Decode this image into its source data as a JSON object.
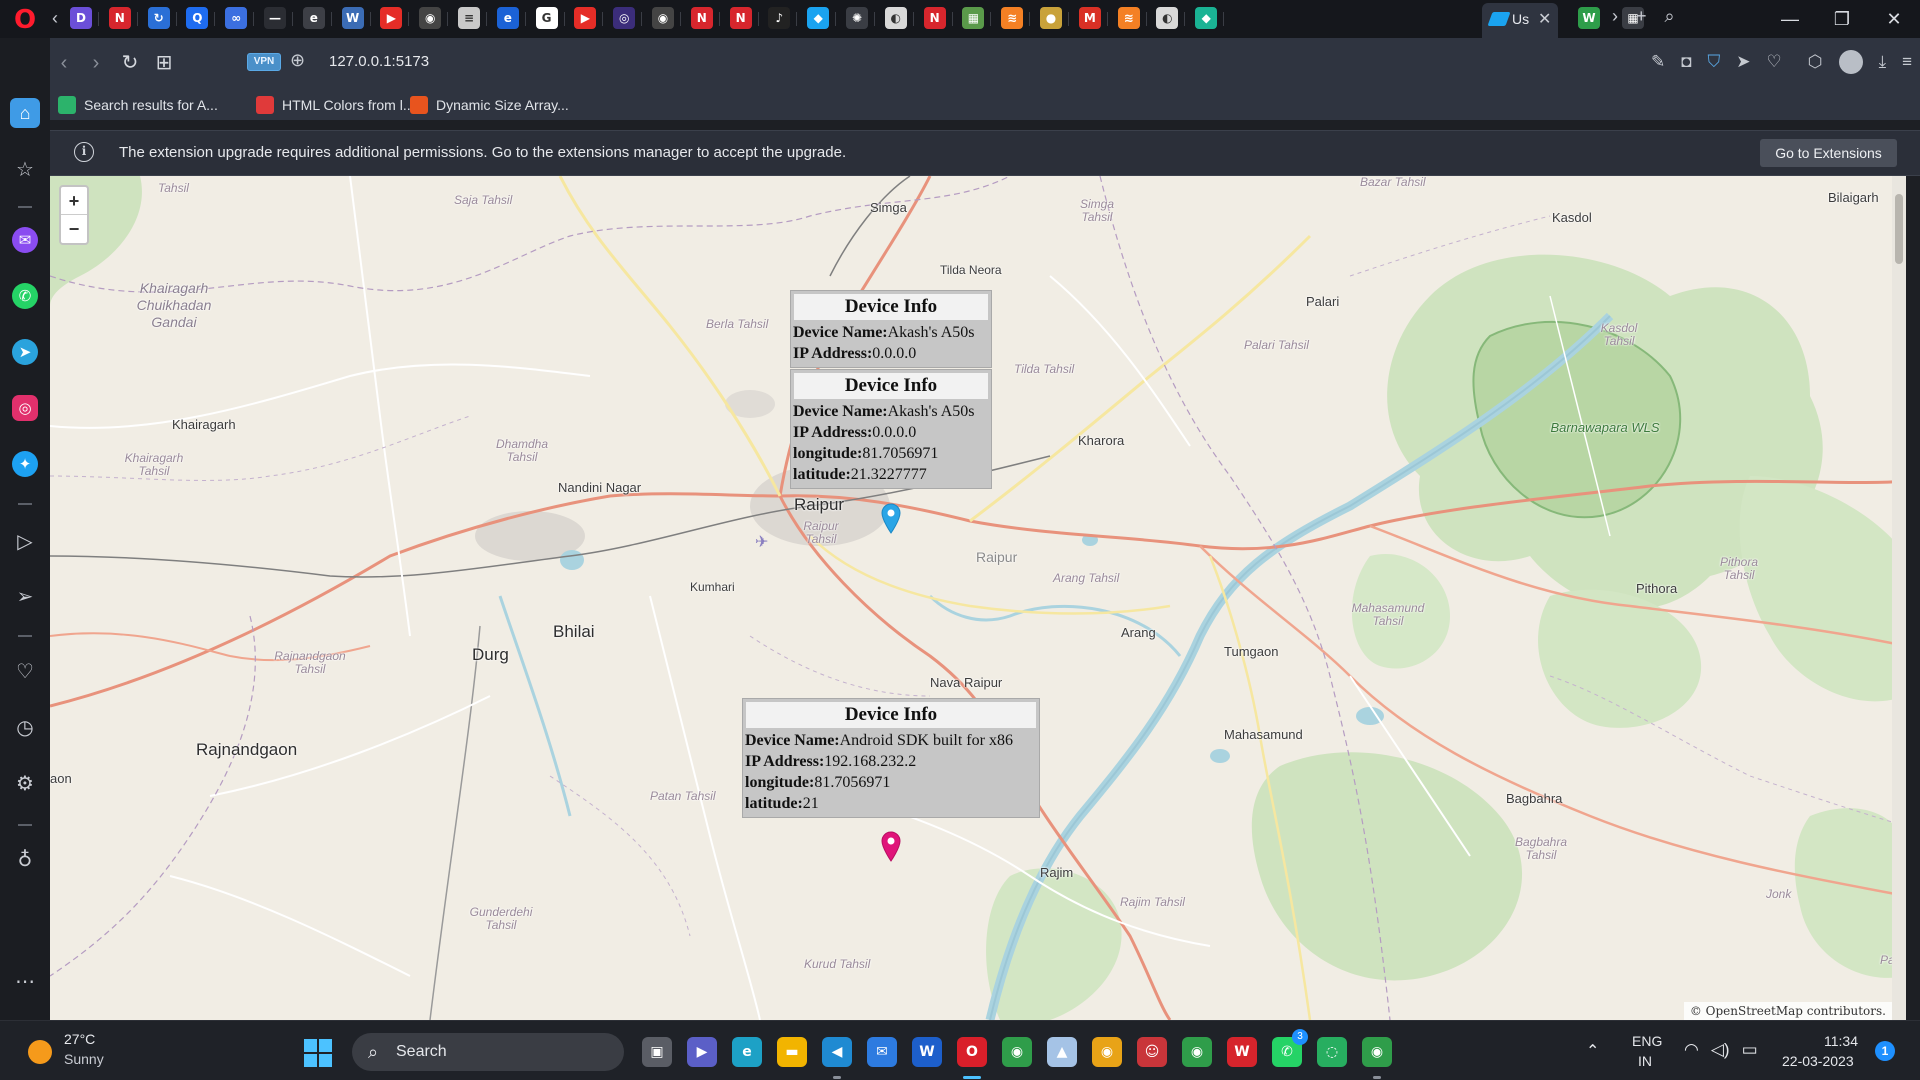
{
  "browser": {
    "name": "Opera",
    "tabs": {
      "favicons": [
        {
          "icon": "d-icon",
          "glyph": "D",
          "color": "#6b4fd8"
        },
        {
          "icon": "n-red-icon",
          "glyph": "N",
          "color": "#d7262d"
        },
        {
          "icon": "sync-icon",
          "glyph": "↻",
          "color": "#2a6fd6"
        },
        {
          "icon": "q-blue-icon",
          "glyph": "Q",
          "color": "#1e6cf0"
        },
        {
          "icon": "infinity-icon",
          "glyph": "∞",
          "color": "#3b6fe0"
        },
        {
          "icon": "dash-icon",
          "glyph": "—",
          "color": "#2b2d33"
        },
        {
          "icon": "edge-icon",
          "glyph": "e",
          "color": "#3d3f46"
        },
        {
          "icon": "wordpress-icon",
          "glyph": "W",
          "color": "#3b6cb5"
        },
        {
          "icon": "youtube-icon",
          "glyph": "▶",
          "color": "#e52d27"
        },
        {
          "icon": "github-icon",
          "glyph": "◉",
          "color": "#444"
        },
        {
          "icon": "doc-icon",
          "glyph": "≡",
          "color": "#c9c9c9"
        },
        {
          "icon": "e-blue-icon",
          "glyph": "e",
          "color": "#1b62d6"
        },
        {
          "icon": "google-icon",
          "glyph": "G",
          "color": "#ffffff"
        },
        {
          "icon": "youtube-icon",
          "glyph": "▶",
          "color": "#e52d27"
        },
        {
          "icon": "circle-icon",
          "glyph": "◎",
          "color": "#3b2d7a"
        },
        {
          "icon": "github-icon",
          "glyph": "◉",
          "color": "#444"
        },
        {
          "icon": "n-red-icon",
          "glyph": "N",
          "color": "#d7262d"
        },
        {
          "icon": "n-red-icon",
          "glyph": "N",
          "color": "#d7262d"
        },
        {
          "icon": "tiktok-icon",
          "glyph": "♪",
          "color": "#222"
        },
        {
          "icon": "layers-icon",
          "glyph": "◆",
          "color": "#1aa3f0"
        },
        {
          "icon": "chatgpt-icon",
          "glyph": "✺",
          "color": "#3a3d44"
        },
        {
          "icon": "globe-icon",
          "glyph": "◐",
          "color": "#d9d9d9"
        },
        {
          "icon": "n-red-icon",
          "glyph": "N",
          "color": "#d7262d"
        },
        {
          "icon": "map-icon",
          "glyph": "▦",
          "color": "#5a9a4a"
        },
        {
          "icon": "stack-icon",
          "glyph": "≋",
          "color": "#f48024"
        },
        {
          "icon": "coin-icon",
          "glyph": "●",
          "color": "#c9a23a"
        },
        {
          "icon": "gmail-icon",
          "glyph": "M",
          "color": "#d93025"
        },
        {
          "icon": "stack-icon",
          "glyph": "≋",
          "color": "#f48024"
        },
        {
          "icon": "globe-icon",
          "glyph": "◐",
          "color": "#d9d9d9"
        },
        {
          "icon": "diamond-icon",
          "glyph": "◆",
          "color": "#1ab394"
        }
      ],
      "active_label": "Us",
      "after_favicons": [
        {
          "icon": "w-green-icon",
          "glyph": "W",
          "color": "#2e9d4a"
        },
        {
          "icon": "grid-icon",
          "glyph": "▦",
          "color": "#3a3d44"
        }
      ]
    },
    "address": {
      "vpn_label": "VPN",
      "url": "127.0.0.1:5173"
    },
    "bookmarks": [
      {
        "label": "Search results for A...",
        "icon": "v-green-icon",
        "color": "#2cb36b"
      },
      {
        "label": "HTML Colors from l...",
        "icon": "color-wheel-icon",
        "color": "#e03a3a"
      },
      {
        "label": "Dynamic Size Array...",
        "icon": "c-orange-icon",
        "color": "#e8541e"
      }
    ],
    "notification": {
      "text": "The extension upgrade requires additional permissions. Go to the extensions manager to accept the upgrade.",
      "button": "Go to Extensions"
    }
  },
  "map": {
    "zoom_in": "+",
    "zoom_out": "−",
    "attribution": "© OpenStreetMap contributors.",
    "places": [
      {
        "name": "Simga",
        "kind": "city"
      },
      {
        "name": "Tilda Neora",
        "kind": "place"
      },
      {
        "name": "Palari",
        "kind": "place"
      },
      {
        "name": "Kasdol",
        "kind": "place"
      },
      {
        "name": "Bilaigarh",
        "kind": "place"
      },
      {
        "name": "Khairagarh",
        "kind": "place"
      },
      {
        "name": "Nandini Nagar",
        "kind": "place"
      },
      {
        "name": "Kharora",
        "kind": "place"
      },
      {
        "name": "Raipur",
        "kind": "big"
      },
      {
        "name": "Raipur",
        "kind": "place"
      },
      {
        "name": "Kumhari",
        "kind": "place"
      },
      {
        "name": "Bhilai",
        "kind": "big"
      },
      {
        "name": "Durg",
        "kind": "big"
      },
      {
        "name": "Rajnandgaon",
        "kind": "big"
      },
      {
        "name": "Arang",
        "kind": "place"
      },
      {
        "name": "Tumgaon",
        "kind": "place"
      },
      {
        "name": "Nava Raipur",
        "kind": "place"
      },
      {
        "name": "Mahasamund",
        "kind": "place"
      },
      {
        "name": "Pithora",
        "kind": "place"
      },
      {
        "name": "Bagbahra",
        "kind": "place"
      },
      {
        "name": "Rajim",
        "kind": "place"
      },
      {
        "name": "aon",
        "kind": "place"
      }
    ],
    "tehsils": [
      {
        "name": "Saja Tahsil"
      },
      {
        "name": "Simga Tahsil"
      },
      {
        "name": "Berla Tahsil"
      },
      {
        "name": "Tilda Tahsil"
      },
      {
        "name": "Palari Tahsil"
      },
      {
        "name": "Kasdol Tahsil"
      },
      {
        "name": "Khairagarh Chuikhadan Gandai"
      },
      {
        "name": "Khairagarh Tahsil"
      },
      {
        "name": "Dhamdha Tahsil"
      },
      {
        "name": "Raipur Tahsil"
      },
      {
        "name": "Arang Tahsil"
      },
      {
        "name": "Rajnandgaon Tahsil"
      },
      {
        "name": "Mahasamund Tahsil"
      },
      {
        "name": "Pithora Tahsil"
      },
      {
        "name": "Patan Tahsil"
      },
      {
        "name": "Gunderdehi Tahsil"
      },
      {
        "name": "Rajim Tahsil"
      },
      {
        "name": "Bagbahra Tahsil"
      },
      {
        "name": "Kurud Tahsil"
      },
      {
        "name": "Bazar Tahsil"
      },
      {
        "name": "Tahsil"
      },
      {
        "name": "Jonk"
      },
      {
        "name": "Paik"
      }
    ],
    "wls": "Barnawapara WLS",
    "popups": [
      {
        "title": "Device Info",
        "rows": [
          {
            "label": "Device Name:",
            "value": "Akash's A50s"
          },
          {
            "label": "IP Address:",
            "value": "0.0.0.0"
          }
        ]
      },
      {
        "title": "Device Info",
        "rows": [
          {
            "label": "Device Name:",
            "value": "Akash's A50s"
          },
          {
            "label": "IP Address:",
            "value": "0.0.0.0"
          },
          {
            "label": "longitude:",
            "value": "81.7056971"
          },
          {
            "label": "latitude:",
            "value": "21.3227777"
          }
        ]
      },
      {
        "title": "Device Info",
        "rows": [
          {
            "label": "Device Name:",
            "value": "Android SDK built for x86"
          },
          {
            "label": "IP Address:",
            "value": "192.168.232.2"
          },
          {
            "label": "longitude:",
            "value": "81.7056971"
          },
          {
            "label": "latitude:",
            "value": "21"
          }
        ]
      }
    ],
    "markers": [
      {
        "color": "#2aa5e6"
      },
      {
        "color": "#e0147a"
      }
    ]
  },
  "taskbar": {
    "weather_temp": "27°C",
    "weather_desc": "Sunny",
    "search_label": "Search",
    "apps": [
      {
        "icon": "task-view-icon",
        "glyph": "▣",
        "color": "#5a5d65"
      },
      {
        "icon": "teams-icon",
        "glyph": "▶",
        "color": "#5b5fc7"
      },
      {
        "icon": "edge-icon",
        "glyph": "e",
        "color": "#1da1c6"
      },
      {
        "icon": "file-explorer-icon",
        "glyph": "▬",
        "color": "#f2b400"
      },
      {
        "icon": "vscode-icon",
        "glyph": "◀",
        "color": "#1f8ad2"
      },
      {
        "icon": "mail-icon",
        "glyph": "✉",
        "color": "#2d7be0"
      },
      {
        "icon": "w-app-icon",
        "glyph": "W",
        "color": "#1d5fcb"
      },
      {
        "icon": "opera-icon",
        "glyph": "O",
        "color": "#d91f2a"
      },
      {
        "icon": "chrome-icon",
        "glyph": "◉",
        "color": "#2f9d4a"
      },
      {
        "icon": "chart-app-icon",
        "glyph": "▲",
        "color": "#a5c3e6"
      },
      {
        "icon": "chrome-canary-icon",
        "glyph": "◉",
        "color": "#e8a317"
      },
      {
        "icon": "bot-icon",
        "glyph": "☺",
        "color": "#c9353a"
      },
      {
        "icon": "chrome-icon",
        "glyph": "◉",
        "color": "#2f9d4a"
      },
      {
        "icon": "wps-icon",
        "glyph": "W",
        "color": "#d6242c"
      },
      {
        "icon": "whatsapp-icon",
        "glyph": "✆",
        "color": "#25d366"
      },
      {
        "icon": "spinner-icon",
        "glyph": "◌",
        "color": "#27ae60"
      },
      {
        "icon": "chrome-profile-icon",
        "glyph": "◉",
        "color": "#2f9d4a"
      }
    ],
    "whatsapp_badge": "3",
    "lang_line1": "ENG",
    "lang_line2": "IN",
    "time": "11:34",
    "date": "22-03-2023",
    "notif_count": "1"
  }
}
